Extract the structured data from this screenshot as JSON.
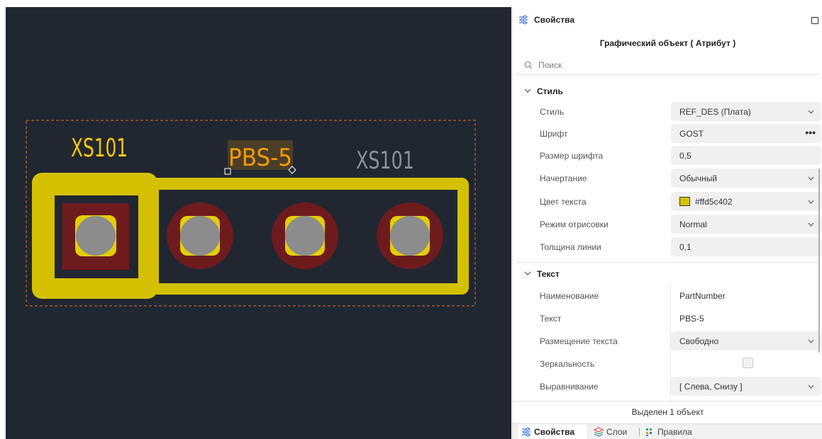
{
  "canvas": {
    "background": "#212731",
    "component_ref_label": "XS101",
    "selected_attribute_text": "PBS-5",
    "secondary_ref_label": "XS101",
    "colors": {
      "outline": "#d4c000",
      "pad_ring": "#6e1b1e",
      "pad_core": "#e5ce00",
      "drill": "#8c8c8c",
      "courtyard": "#b3642a",
      "label_yellow": "#f5c800",
      "label_gray": "#8a8f98",
      "label_orange": "#f59a00"
    }
  },
  "panel": {
    "title": "Свойства",
    "object_title": "Графический объект ( Атрибут )",
    "search": {
      "placeholder": "Поиск"
    },
    "style_section": {
      "label": "Стиль",
      "rows": [
        {
          "label": "Стиль",
          "value": "REF_DES (Плата)",
          "control": "dropdown"
        },
        {
          "label": "Шрифт",
          "value": "GOST",
          "control": "more"
        },
        {
          "label": "Размер шрифта",
          "value": "0,5",
          "control": "input"
        },
        {
          "label": "Начертание",
          "value": "Обычный",
          "control": "dropdown"
        },
        {
          "label": "Цвет текста",
          "value": "#ffd5c402",
          "control": "color-dropdown",
          "swatch": "#d5c402"
        },
        {
          "label": "Режим отрисовки",
          "value": "Normal",
          "control": "dropdown"
        },
        {
          "label": "Толщина линии",
          "value": "0,1",
          "control": "input"
        }
      ]
    },
    "text_section": {
      "label": "Текст",
      "rows": [
        {
          "label": "Наименование",
          "value": "PartNumber",
          "control": "static"
        },
        {
          "label": "Текст",
          "value": "PBS-5",
          "control": "static"
        },
        {
          "label": "Размещение текста",
          "value": "Свободно",
          "control": "dropdown"
        },
        {
          "label": "Зеркальность",
          "value": "",
          "control": "checkbox",
          "checked": false
        },
        {
          "label": "Выравнивание",
          "value": "[ Слева, Снизу ]",
          "control": "dropdown"
        }
      ]
    },
    "status": "Выделен 1 объект",
    "tabs": [
      {
        "label": "Свойства",
        "icon": "sliders-icon",
        "active": true
      },
      {
        "label": "Слои",
        "icon": "layers-icon",
        "active": false
      },
      {
        "label": "Правила",
        "icon": "rules-grid-icon",
        "active": false
      }
    ]
  }
}
